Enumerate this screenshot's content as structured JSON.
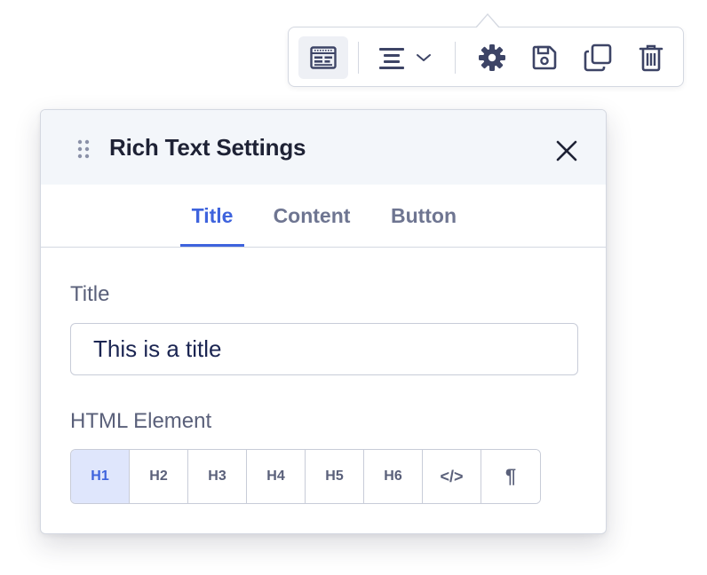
{
  "toolbar": {
    "buttons": [
      {
        "name": "layout-icon",
        "active": true
      },
      {
        "name": "align-center-icon"
      },
      {
        "name": "gear-icon"
      },
      {
        "name": "save-icon"
      },
      {
        "name": "duplicate-icon"
      },
      {
        "name": "trash-icon"
      }
    ]
  },
  "panel": {
    "title": "Rich Text Settings",
    "tabs": [
      {
        "label": "Title",
        "active": true
      },
      {
        "label": "Content"
      },
      {
        "label": "Button"
      }
    ],
    "title_field": {
      "label": "Title",
      "value": "This is a title"
    },
    "html_element": {
      "label": "HTML Element",
      "options": [
        "H1",
        "H2",
        "H3",
        "H4",
        "H5",
        "H6",
        "</>",
        "¶"
      ],
      "selected": "H1"
    }
  },
  "colors": {
    "accent": "#3e63dd",
    "accent_bg": "#dfe6fc",
    "icon": "#3d4466",
    "border": "#d4d8e1",
    "header_bg": "#f3f6fa"
  }
}
